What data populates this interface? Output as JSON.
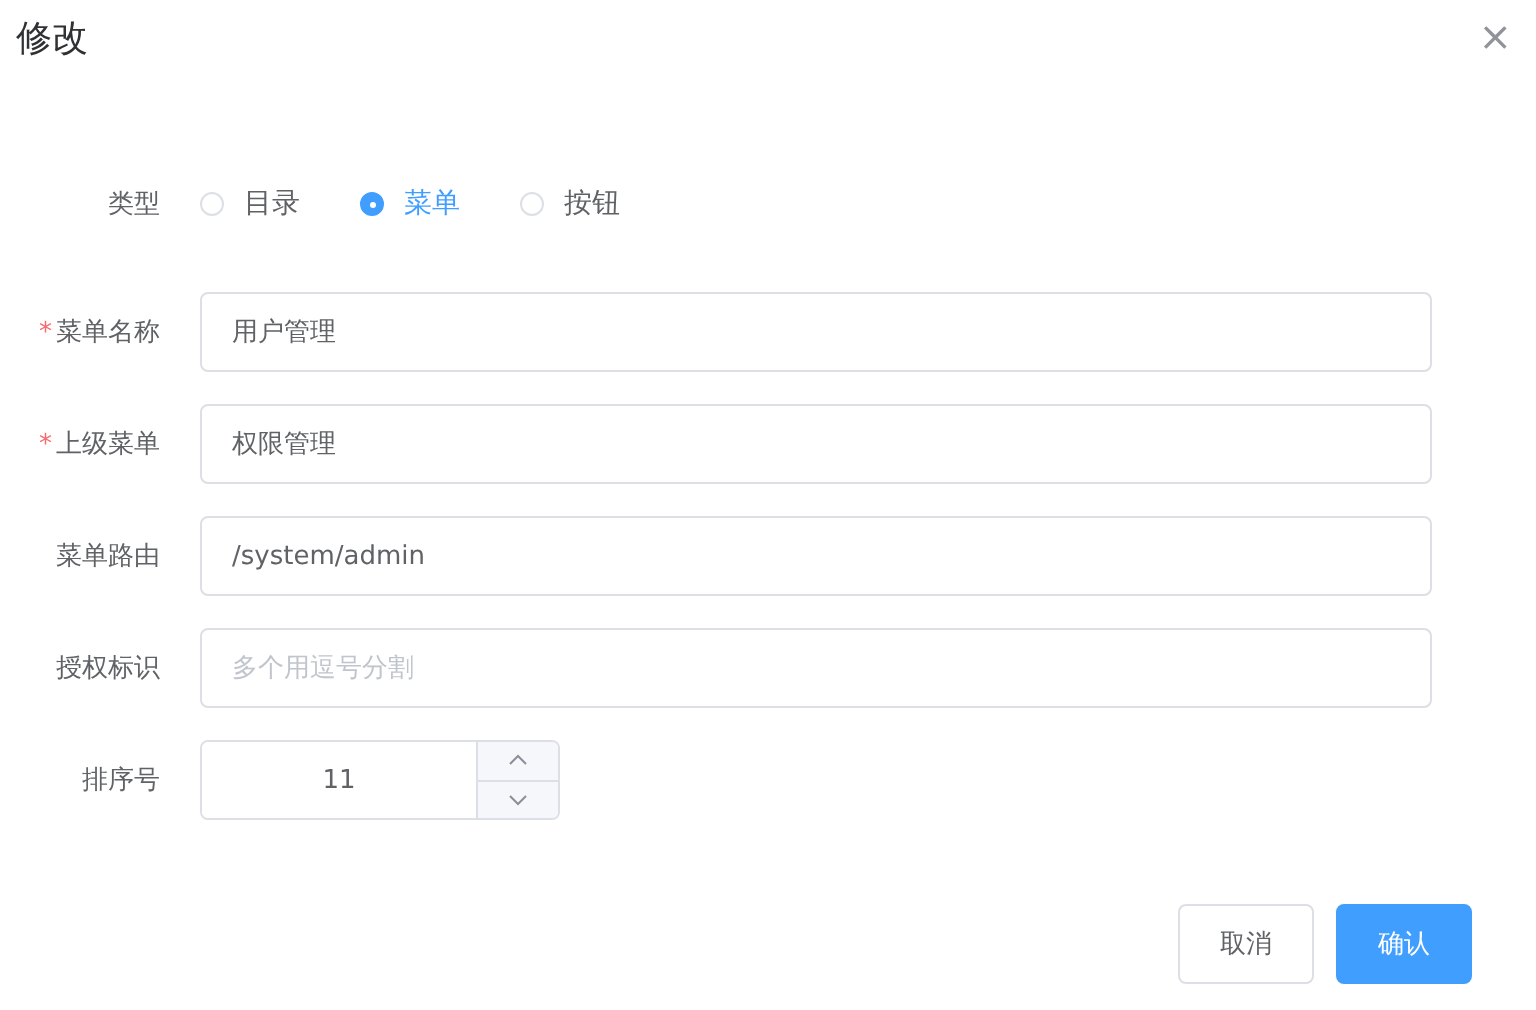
{
  "dialog": {
    "title": "修改",
    "close": "×"
  },
  "type_field": {
    "label": "类型",
    "options": [
      {
        "label": "目录",
        "selected": false
      },
      {
        "label": "菜单",
        "selected": true
      },
      {
        "label": "按钮",
        "selected": false
      }
    ]
  },
  "required_mark": "*",
  "fields": [
    {
      "kind": "text",
      "label": "菜单名称",
      "required": true,
      "value": "用户管理"
    },
    {
      "kind": "text",
      "label": "上级菜单",
      "required": true,
      "value": "权限管理"
    },
    {
      "kind": "text",
      "label": "菜单路由",
      "required": false,
      "value": "/system/admin"
    },
    {
      "kind": "text",
      "label": "授权标识",
      "required": false,
      "placeholder": "多个用逗号分割"
    },
    {
      "kind": "number",
      "label": "排序号",
      "required": false,
      "value": "11"
    }
  ],
  "buttons": [
    {
      "label": "取消",
      "primary": false
    },
    {
      "label": "确认",
      "primary": true
    }
  ]
}
